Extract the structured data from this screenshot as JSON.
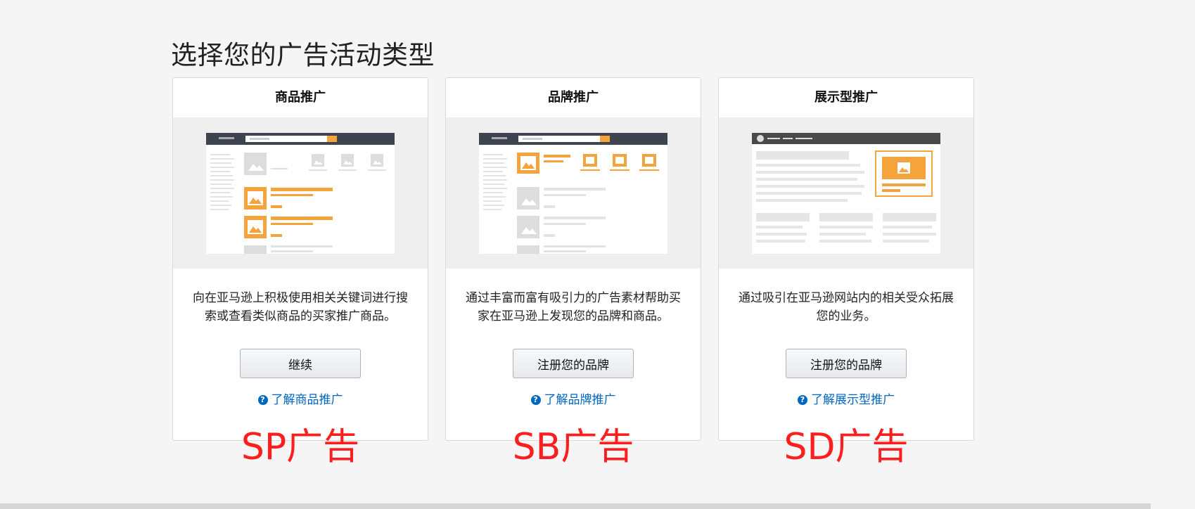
{
  "page": {
    "title": "选择您的广告活动类型"
  },
  "cards": [
    {
      "title": "商品推广",
      "description": "向在亚马逊上积极使用相关关键词进行搜索或查看类似商品的买家推广商品。",
      "button_label": "继续",
      "link_label": "了解商品推广",
      "annotation": "SP广告"
    },
    {
      "title": "品牌推广",
      "description": "通过丰富而富有吸引力的广告素材帮助买家在亚马逊上发现您的品牌和商品。",
      "button_label": "注册您的品牌",
      "link_label": "了解品牌推广",
      "annotation": "SB广告"
    },
    {
      "title": "展示型推广",
      "description": "通过吸引在亚马逊网站内的相关受众拓展您的业务。",
      "button_label": "注册您的品牌",
      "link_label": "了解展示型推广",
      "annotation": "SD广告"
    }
  ],
  "colors": {
    "accent_orange": "#f5a33b",
    "link_blue": "#0066c0",
    "annotation_red": "#ff1e1e",
    "header_dark": "#3d4450"
  },
  "icons": {
    "help": "question-circle-icon"
  }
}
